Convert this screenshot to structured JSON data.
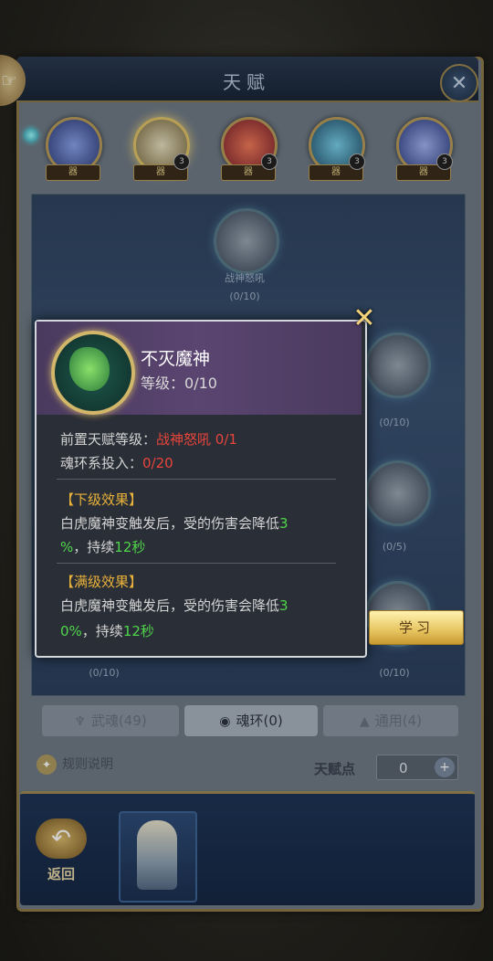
{
  "window": {
    "title": "天赋"
  },
  "categories": [
    {
      "tag": "器",
      "badge": ""
    },
    {
      "tag": "器",
      "badge": "3"
    },
    {
      "tag": "器",
      "badge": "3"
    },
    {
      "tag": "器",
      "badge": "3"
    },
    {
      "tag": "器",
      "badge": "3"
    }
  ],
  "tree": {
    "nodes": [
      {
        "label": "战神怒吼",
        "progress": "(0/10)"
      },
      {
        "label": "",
        "progress": "(0/10)"
      },
      {
        "label": "",
        "progress": "(0/5)"
      },
      {
        "label": "",
        "progress": "(0/10)"
      },
      {
        "label": "",
        "progress": "(0/10)"
      }
    ]
  },
  "tabs": [
    {
      "label": "武魂(49)",
      "icon": "weapon-icon"
    },
    {
      "label": "魂环(0)",
      "icon": "ring-icon"
    },
    {
      "label": "通用(4)",
      "icon": "general-icon"
    }
  ],
  "footer": {
    "rules_label": "规则说明",
    "points_label": "天赋点",
    "points_value": "0"
  },
  "dock": {
    "back_label": "返回"
  },
  "popup": {
    "skill_name": "不灭魔神",
    "level_label": "等级：",
    "level_value": "0/10",
    "prereq_label": "前置天赋等级：",
    "prereq_value": "战神怒吼 0/1",
    "invest_label": "魂环系投入：",
    "invest_value": "0/20",
    "next_title": "【下级效果】",
    "next_line1": "白虎魔神变触发后，受的伤害会降低",
    "next_line1_num": "3",
    "next_line2_num": "%",
    "next_line2_mid": "，持续",
    "next_line2_dur": "12秒",
    "max_title": "【满级效果】",
    "max_line1": "白虎魔神变触发后，受的伤害会降低",
    "max_line1_num": "3",
    "max_line2_num": "0%",
    "max_line2_mid": "，持续",
    "max_line2_dur": "12秒"
  },
  "learn_button": "学习",
  "colors": {
    "prereq_red": "#e8453c",
    "effect_green": "#4fd64a",
    "section_gold": "#e9b23a",
    "frame_gold": "#a08a52"
  }
}
